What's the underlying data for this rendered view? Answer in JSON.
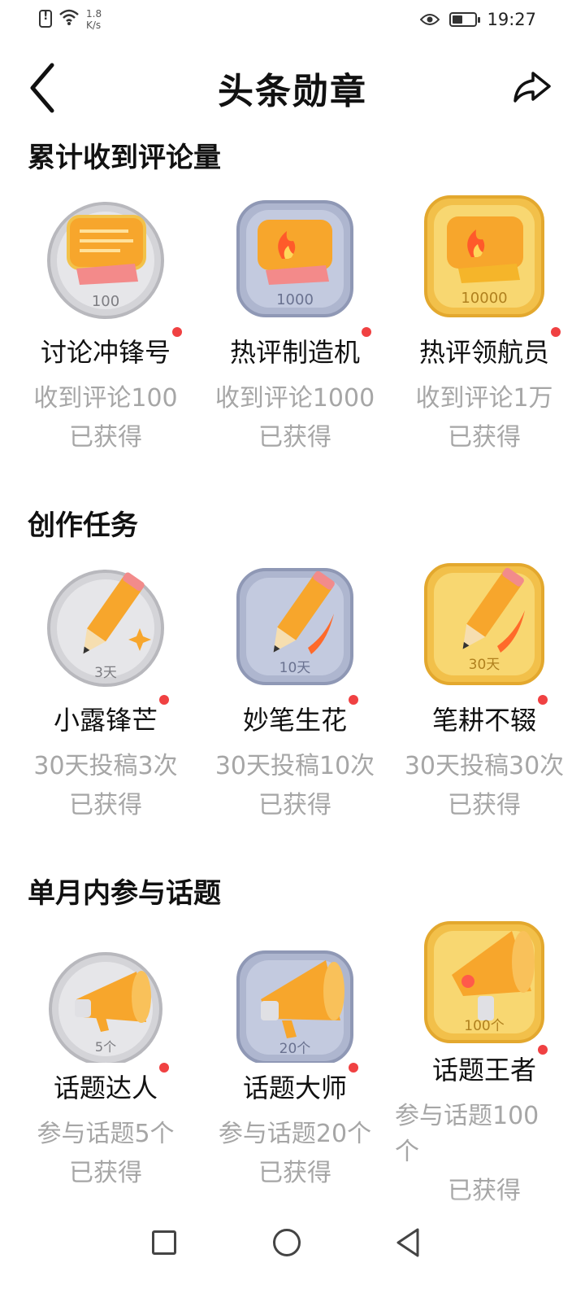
{
  "status_bar": {
    "net_speed_value": "1.8",
    "net_speed_unit": "K/s",
    "time": "19:27",
    "icons": [
      "alert-icon",
      "wifi-icon",
      "eye-icon",
      "battery-icon"
    ]
  },
  "header": {
    "title": "头条勋章",
    "back_icon": "chevron-left-icon",
    "share_icon": "share-icon"
  },
  "sections": [
    {
      "title": "累计收到评论量",
      "badges": [
        {
          "name": "讨论冲锋号",
          "desc": "收到评论100",
          "status": "已获得",
          "icon_label": "100",
          "tier": "silver",
          "icon": "comment-scroll-icon",
          "new": true
        },
        {
          "name": "热评制造机",
          "desc": "收到评论1000",
          "status": "已获得",
          "icon_label": "1000",
          "tier": "blue",
          "icon": "fire-scroll-icon",
          "new": true
        },
        {
          "name": "热评领航员",
          "desc": "收到评论1万",
          "status": "已获得",
          "icon_label": "10000",
          "tier": "gold",
          "icon": "fire-scroll-icon",
          "new": true
        }
      ]
    },
    {
      "title": "创作任务",
      "badges": [
        {
          "name": "小露锋芒",
          "desc": "30天投稿3次",
          "status": "已获得",
          "icon_label": "3天",
          "tier": "silver",
          "icon": "pencil-icon",
          "new": true
        },
        {
          "name": "妙笔生花",
          "desc": "30天投稿10次",
          "status": "已获得",
          "icon_label": "10天",
          "tier": "blue",
          "icon": "pencil-icon",
          "new": true
        },
        {
          "name": "笔耕不辍",
          "desc": "30天投稿30次",
          "status": "已获得",
          "icon_label": "30天",
          "tier": "gold",
          "icon": "pencil-icon",
          "new": true
        }
      ]
    },
    {
      "title": "单月内参与话题",
      "badges": [
        {
          "name": "话题达人",
          "desc": "参与话题5个",
          "status": "已获得",
          "icon_label": "5个",
          "tier": "silver",
          "icon": "megaphone-icon",
          "new": true
        },
        {
          "name": "话题大师",
          "desc": "参与话题20个",
          "status": "已获得",
          "icon_label": "20个",
          "tier": "blue",
          "icon": "megaphone-icon",
          "new": true
        },
        {
          "name": "话题王者",
          "desc_line1": "参与话题100",
          "desc_line2": "个",
          "status": "已获得",
          "icon_label": "100个",
          "tier": "gold",
          "icon": "megaphone-icon",
          "new": true
        }
      ]
    }
  ],
  "nav_bar": {
    "icons": [
      "recent-apps-icon",
      "home-icon",
      "back-triangle-icon"
    ]
  },
  "colors": {
    "accent_dot": "#f04142",
    "secondary_text": "#a6a6a6",
    "silver_tier": "#c9c9cd",
    "blue_tier": "#a9b2cc",
    "gold_tier": "#f5c94e",
    "icon_orange": "#f7a62c"
  }
}
